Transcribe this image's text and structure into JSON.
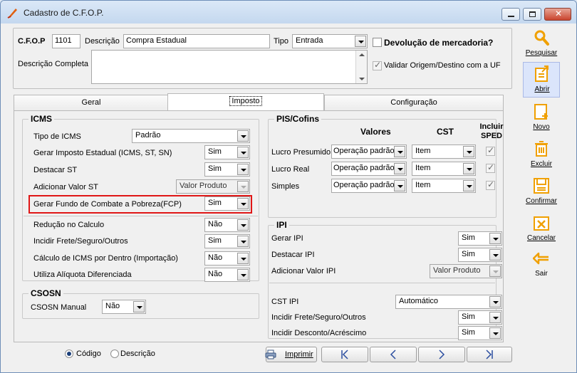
{
  "window": {
    "title": "Cadastro de C.F.O.P."
  },
  "header": {
    "cfop_label": "C.F.O.P",
    "cfop_value": "1101",
    "descricao_label": "Descrição",
    "descricao_value": "Compra Estadual",
    "tipo_label": "Tipo",
    "tipo_value": "Entrada",
    "devolucao_label": "Devolução de mercadoria?",
    "devolucao_checked": false,
    "descricao_completa_label": "Descrição Completa",
    "descricao_completa_value": "",
    "validar_label": "Validar Origem/Destino com a UF",
    "validar_checked": true
  },
  "tabs": [
    {
      "label": "Geral",
      "active": false
    },
    {
      "label": "Imposto",
      "active": true
    },
    {
      "label": "Configuração",
      "active": false
    }
  ],
  "icms": {
    "title": "ICMS",
    "rows": [
      {
        "label": "Tipo de ICMS",
        "value": "Padrão"
      },
      {
        "label": "Gerar Imposto Estadual (ICMS, ST, SN)",
        "value": "Sim"
      },
      {
        "label": "Destacar ST",
        "value": "Sim"
      },
      {
        "label": "Adicionar Valor ST",
        "value": "Valor Produto"
      },
      {
        "label": "Gerar Fundo de Combate a Pobreza(FCP)",
        "value": "Sim"
      },
      {
        "label": "Redução no Calculo",
        "value": "Não"
      },
      {
        "label": "Incidir Frete/Seguro/Outros",
        "value": "Sim"
      },
      {
        "label": "Cálculo de ICMS por Dentro  (Importação)",
        "value": "Não"
      },
      {
        "label": "Utiliza Alíquota Diferenciada",
        "value": "Não"
      }
    ]
  },
  "csosn": {
    "title": "CSOSN",
    "label": "CSOSN Manual",
    "value": "Não"
  },
  "pis_cofins": {
    "title": "PIS/Cofins",
    "col_valores": "Valores",
    "col_cst": "CST",
    "col_incluir": "Incluir SPED",
    "rows": [
      {
        "label": "Lucro Presumido",
        "valor": "Operação padrão",
        "cst": "Item",
        "incluir": true
      },
      {
        "label": "Lucro Real",
        "valor": "Operação padrão",
        "cst": "Item",
        "incluir": true
      },
      {
        "label": "Simples",
        "valor": "Operação padrão",
        "cst": "Item",
        "incluir": true
      }
    ]
  },
  "ipi": {
    "title": "IPI",
    "rows": [
      {
        "label": "Gerar IPI",
        "value": "Sim"
      },
      {
        "label": "Destacar IPI",
        "value": "Sim"
      },
      {
        "label": "Adicionar Valor IPI",
        "value": "Valor Produto"
      },
      {
        "label": "CST IPI",
        "value": "Automático"
      },
      {
        "label": "Incidir Frete/Seguro/Outros",
        "value": "Sim"
      },
      {
        "label": "Incidir Desconto/Acréscimo",
        "value": "Sim"
      }
    ]
  },
  "footer": {
    "radio_codigo": "Código",
    "radio_descricao": "Descrição",
    "selected": "codigo",
    "imprimir_label": "Imprimir"
  },
  "sidebar": [
    {
      "label": "Pesquisar",
      "icon": "search-icon"
    },
    {
      "label": "Abrir",
      "icon": "open-icon"
    },
    {
      "label": "Novo",
      "icon": "new-icon"
    },
    {
      "label": "Excluir",
      "icon": "trash-icon"
    },
    {
      "label": "Confirmar",
      "icon": "save-icon"
    },
    {
      "label": "Cancelar",
      "icon": "cancel-icon"
    },
    {
      "label": "Sair",
      "icon": "exit-icon"
    }
  ],
  "colors": {
    "accent": "#e01616",
    "icon_orange": "#f0a000"
  }
}
